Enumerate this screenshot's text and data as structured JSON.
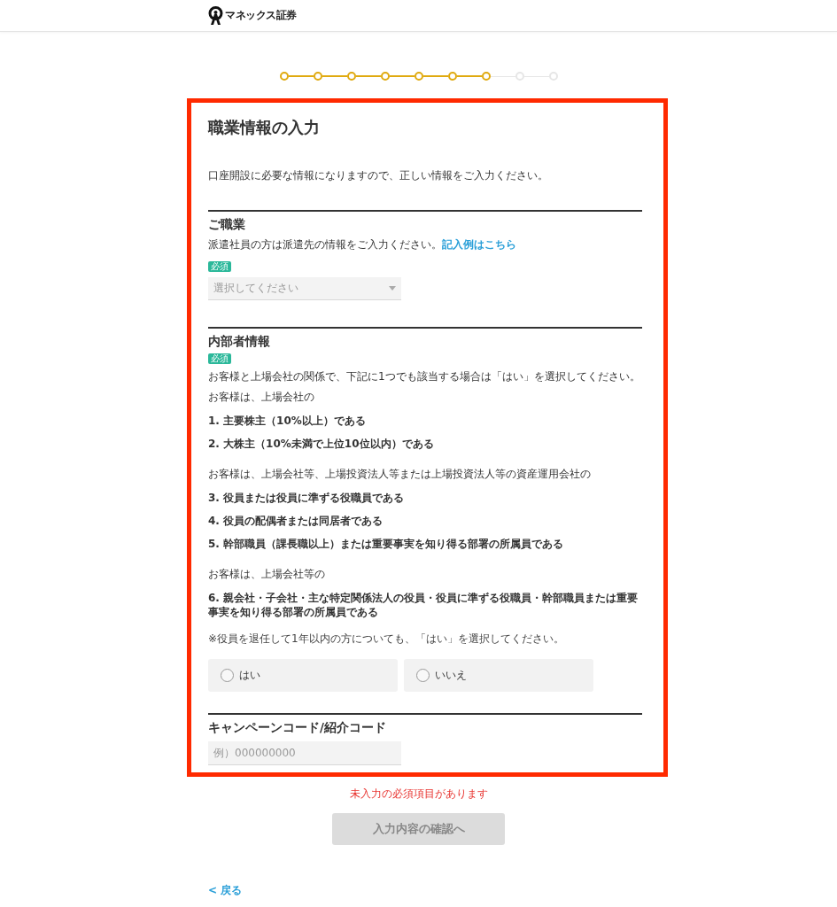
{
  "header": {
    "logo_text": "マネックス証券"
  },
  "stepper": {
    "steps": [
      {
        "done": true
      },
      {
        "done": true
      },
      {
        "done": true
      },
      {
        "done": true
      },
      {
        "done": true
      },
      {
        "done": true
      },
      {
        "done": true
      },
      {
        "done": false
      },
      {
        "done": false
      }
    ]
  },
  "form": {
    "title": "職業情報の入力",
    "intro": "口座開設に必要な情報になりますので、正しい情報をご入力ください。",
    "occupation": {
      "heading": "ご職業",
      "note": "派遣社員の方は派遣先の情報をご入力ください。",
      "example_link": "記入例はこちら",
      "required_badge": "必須",
      "select": {
        "placeholder": "選択してください"
      }
    },
    "insider": {
      "heading": "内部者情報",
      "required_badge": "必須",
      "paragraphs": [
        {
          "kind": "text",
          "text": "お客様と上場会社の関係で、下記に1つでも該当する場合は「はい」を選択してください。"
        },
        {
          "kind": "text",
          "text": "お客様は、上場会社の"
        },
        {
          "kind": "item",
          "text": "1. 主要株主（10%以上）である"
        },
        {
          "kind": "item",
          "text": "2. 大株主（10%未満で上位10位以内）である"
        },
        {
          "kind": "lead",
          "text": "お客様は、上場会社等、上場投資法人等または上場投資法人等の資産運用会社の"
        },
        {
          "kind": "item",
          "text": "3. 役員または役員に準ずる役職員である"
        },
        {
          "kind": "item",
          "text": "4. 役員の配偶者または同居者である"
        },
        {
          "kind": "item",
          "text": "5. 幹部職員（課長職以上）または重要事実を知り得る部署の所属員である"
        },
        {
          "kind": "lead",
          "text": "お客様は、上場会社等の"
        },
        {
          "kind": "item",
          "text": "6. 親会社・子会社・主な特定関係法人の役員・役員に準ずる役職員・幹部職員または重要事実を知り得る部署の所属員である"
        },
        {
          "kind": "note",
          "text": "※役員を退任して1年以内の方についても、「はい」を選択してください。"
        }
      ],
      "options": [
        {
          "label": "はい",
          "selected": false
        },
        {
          "label": "いいえ",
          "selected": false
        }
      ]
    },
    "campaign": {
      "heading": "キャンペーンコード/紹介コード",
      "input": {
        "placeholder": "例）000000000"
      }
    }
  },
  "error": "未入力の必須項目があります",
  "confirm_button": {
    "label": "入力内容の確認へ",
    "disabled": true
  },
  "back_link": "< 戻る"
}
